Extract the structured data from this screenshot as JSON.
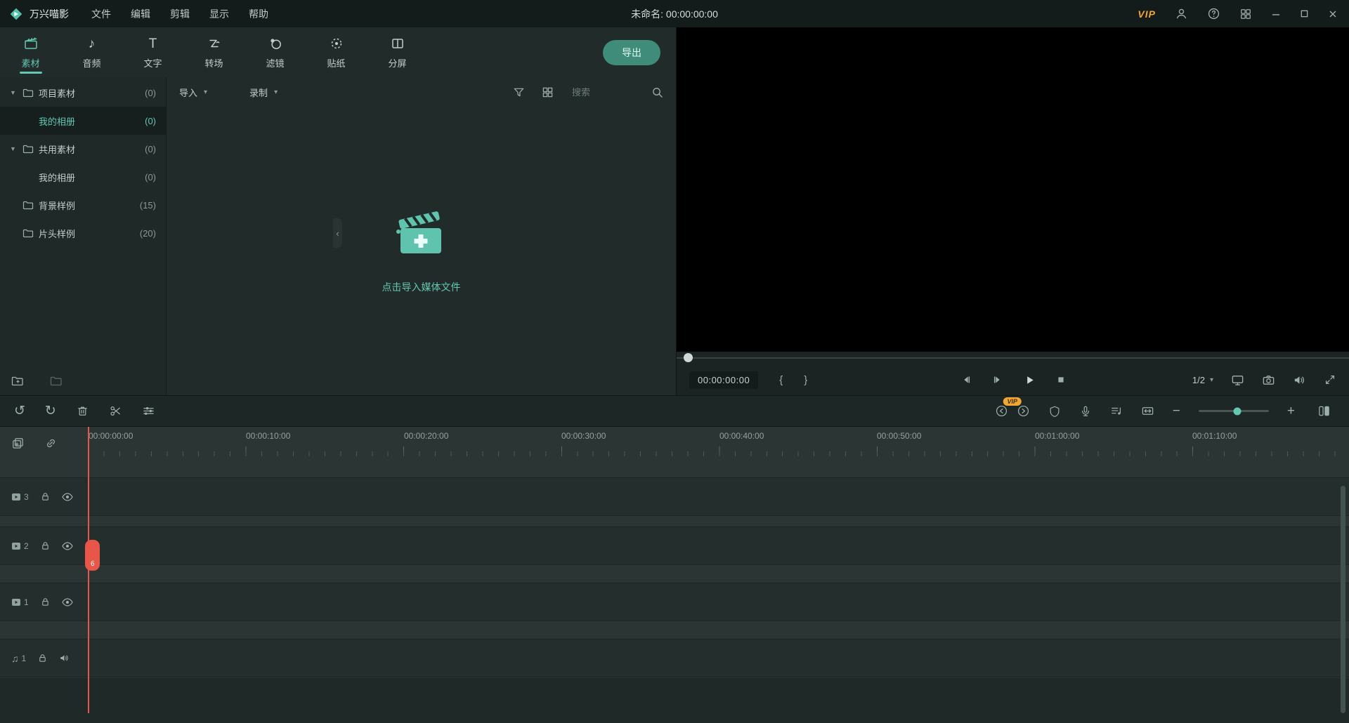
{
  "colors": {
    "accent": "#63c7b2",
    "playhead": "#e8564a",
    "vip": "#f3a63b"
  },
  "icons": {
    "caret_expanded": "▼",
    "caret_down": "▾",
    "chevron_left": "‹",
    "undo": "↺",
    "redo": "↻",
    "zoom_out": "−",
    "zoom_in": "+",
    "brace_open": "{",
    "brace_close": "}",
    "note": "♪",
    "note_double": "♫",
    "text_glyph": "T"
  },
  "topbar": {
    "app_name": "万兴喵影",
    "menus": [
      "文件",
      "编辑",
      "剪辑",
      "显示",
      "帮助"
    ],
    "title": "未命名: 00:00:00:00",
    "vip_label": "VIP"
  },
  "tabs": [
    {
      "label": "素材",
      "active": true
    },
    {
      "label": "音频"
    },
    {
      "label": "文字"
    },
    {
      "label": "转场"
    },
    {
      "label": "滤镜"
    },
    {
      "label": "贴纸"
    },
    {
      "label": "分屏"
    }
  ],
  "export_button": "导出",
  "sidebar": {
    "items": [
      {
        "label": "项目素材",
        "count": "(0)",
        "type": "group"
      },
      {
        "label": "我的相册",
        "count": "(0)",
        "type": "child",
        "active": true
      },
      {
        "label": "共用素材",
        "count": "(0)",
        "type": "group"
      },
      {
        "label": "我的相册",
        "count": "(0)",
        "type": "child"
      },
      {
        "label": "背景样例",
        "count": "(15)",
        "type": "folder"
      },
      {
        "label": "片头样例",
        "count": "(20)",
        "type": "folder"
      }
    ]
  },
  "media": {
    "import_label": "导入",
    "record_label": "录制",
    "search_placeholder": "搜索",
    "empty_caption": "点击导入媒体文件"
  },
  "preview": {
    "timecode": "00:00:00:00",
    "page_indicator": "1/2"
  },
  "toolbar": {
    "vip_badge": "VIP"
  },
  "timeline": {
    "ruler_labels": [
      "00:00:00:00",
      "00:00:10:00",
      "00:00:20:00",
      "00:00:30:00",
      "00:00:40:00",
      "00:00:50:00",
      "00:01:00:00",
      "00:01:10:00"
    ],
    "tracks": [
      {
        "badge": "3",
        "kind": "video"
      },
      {
        "badge": "2",
        "kind": "video"
      },
      {
        "badge": "1",
        "kind": "video"
      },
      {
        "badge": "1",
        "kind": "audio"
      }
    ],
    "clip_marker_label": "6"
  }
}
